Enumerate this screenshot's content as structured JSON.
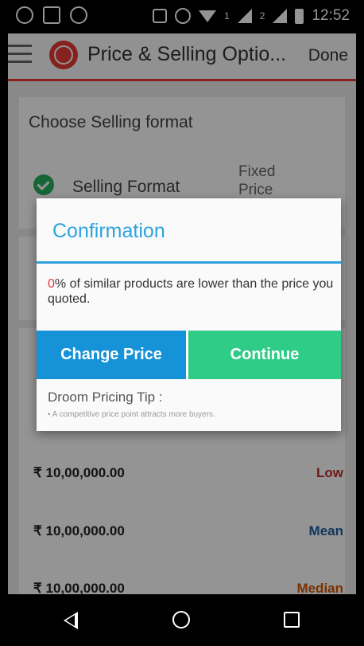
{
  "status_bar": {
    "time": "12:52",
    "sim1_label": "1",
    "sim2_label": "2"
  },
  "app_bar": {
    "title": "Price & Selling Optio...",
    "done_label": "Done"
  },
  "selling_format": {
    "section_title": "Choose Selling format",
    "label": "Selling Format",
    "value_line1": "Fixed",
    "value_line2": "Price"
  },
  "price_rows": [
    {
      "amount": "₹ 10,00,000.00",
      "tag": "Low",
      "color": "#c62828"
    },
    {
      "amount": "₹ 10,00,000.00",
      "tag": "Mean",
      "color": "#1e5fa0"
    },
    {
      "amount": "₹ 10,00,000.00",
      "tag": "Median",
      "color": "#d35400"
    }
  ],
  "dialog": {
    "title": "Confirmation",
    "percent": "0",
    "message": "% of similar products are lower than the price you quoted.",
    "change_price_label": "Change Price",
    "continue_label": "Continue",
    "tip_title": "Droom Pricing Tip :",
    "tip_text": "• A competitive price point attracts more buyers."
  },
  "colors": {
    "accent_red": "#e53935",
    "dialog_blue": "#2ea3dd",
    "change_price_bg": "#1592d8",
    "continue_bg": "#2ecc87"
  }
}
